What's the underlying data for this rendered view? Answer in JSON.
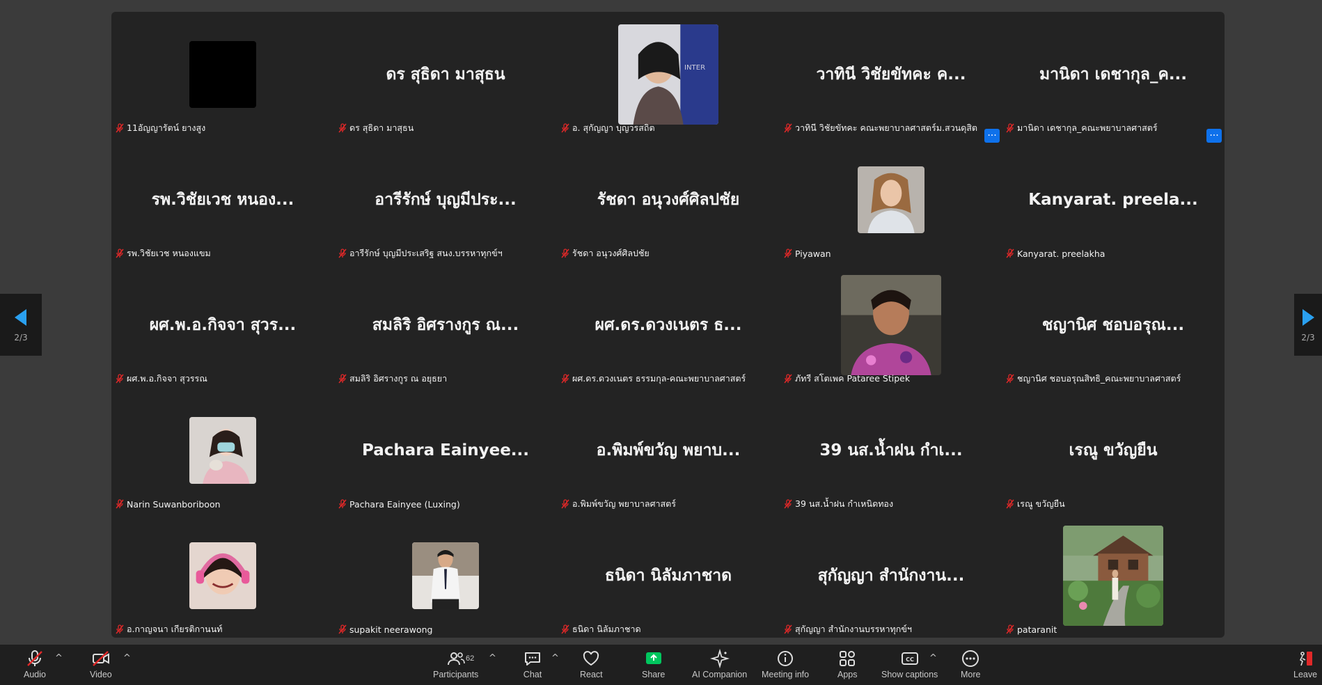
{
  "tiles": [
    {
      "label": "11อัญญารัตน์ ยางสูง",
      "big": "",
      "avatar": "black"
    },
    {
      "label": "ดร สุธิดา มาสุธน",
      "big": "ดร สุธิดา มาสุธน",
      "avatar": ""
    },
    {
      "label": "อ. สุกัญญา บุญวรสถิต",
      "big": "",
      "avatar": "photo-woman-banner"
    },
    {
      "label": "วาทินี วิชัยขัทคะ คณะพยาบาลศาสตร์ม.สวนดุสิต",
      "big": "วาทินี วิชัยขัทคะ ค...",
      "avatar": ""
    },
    {
      "label": "มานิดา เดชากุล_คณะพยาบาลศาสตร์",
      "big": "มานิดา เดชากุล_ค...",
      "avatar": ""
    },
    {
      "label": "รพ.วิชัยเวช หนองแขม",
      "big": "รพ.วิชัยเวช หนอง...",
      "avatar": ""
    },
    {
      "label": "อารีรักษ์ บุญมีประเสริฐ สนง.บรรหาทุกข์ฯ",
      "big": "อารีรักษ์ บุญมีประ...",
      "avatar": ""
    },
    {
      "label": "รัชดา อนุวงศ์ศิลปชัย",
      "big": "รัชดา อนุวงศ์ศิลปชัย",
      "avatar": ""
    },
    {
      "label": "Piyawan",
      "big": "",
      "avatar": "photo-woman-white"
    },
    {
      "label": "Kanyarat. preelakha",
      "big": "Kanyarat. preela...",
      "avatar": ""
    },
    {
      "label": "ผศ.พ.อ.กิจจา สุวรรณ",
      "big": "ผศ.พ.อ.กิจจา สุวร...",
      "avatar": ""
    },
    {
      "label": "สมลิริ อิศรางกูร ณ อยุธยา",
      "big": "สมลิริ อิศรางกูร ณ...",
      "avatar": ""
    },
    {
      "label": "ผศ.ดร.ดวงเนตร ธรรมกุล-คณะพยาบาลศาสตร์",
      "big": "ผศ.ดร.ดวงเนตร ธ...",
      "avatar": ""
    },
    {
      "label": "ภัทรี สโตเพค Pataree Stipek",
      "big": "",
      "avatar": "photo-woman-floral"
    },
    {
      "label": "ชญานิศ ชอบอรุณสิทธิ_คณะพยาบาลศาสตร์",
      "big": "ชญานิศ ชอบอรุณ...",
      "avatar": ""
    },
    {
      "label": "Narin Suwanboriboon",
      "big": "",
      "avatar": "photo-mask"
    },
    {
      "label": "Pachara Eainyee (Luxing)",
      "big": "Pachara Eainyee...",
      "avatar": ""
    },
    {
      "label": "อ.พิมพ์ขวัญ พยาบาลศาสตร์",
      "big": "อ.พิมพ์ขวัญ พยาบ...",
      "avatar": ""
    },
    {
      "label": "39 นส.น้ำฝน กำเหนิดทอง",
      "big": "39 นส.น้ำฝน กำเ...",
      "avatar": ""
    },
    {
      "label": "เรณู ขวัญยืน",
      "big": "เรณู ขวัญยืน",
      "avatar": ""
    },
    {
      "label": "อ.กาญจนา เกียรติกานนท์",
      "big": "",
      "avatar": "photo-headphones"
    },
    {
      "label": "supakit neerawong",
      "big": "",
      "avatar": "photo-man-uniform"
    },
    {
      "label": "ธนิดา นิลัมภาชาด",
      "big": "ธนิดา นิลัมภาชาด",
      "avatar": ""
    },
    {
      "label": "สุกัญญา สำนักงานบรรหาทุกข์ฯ",
      "big": "สุกัญญา สำนักงาน...",
      "avatar": ""
    },
    {
      "label": "pataranit",
      "big": "",
      "avatar": "photo-garden"
    }
  ],
  "pager": {
    "left": "2/3",
    "right": "2/3"
  },
  "toolbar": {
    "audio": "Audio",
    "video": "Video",
    "participants": "Participants",
    "participant_count": "62",
    "chat": "Chat",
    "react": "React",
    "share": "Share",
    "ai": "AI Companion",
    "info": "Meeting info",
    "apps": "Apps",
    "captions": "Show captions",
    "more": "More",
    "leave": "Leave"
  },
  "colors": {
    "accent": "#0e71eb",
    "share": "#00c65e",
    "muted": "#e02828"
  }
}
